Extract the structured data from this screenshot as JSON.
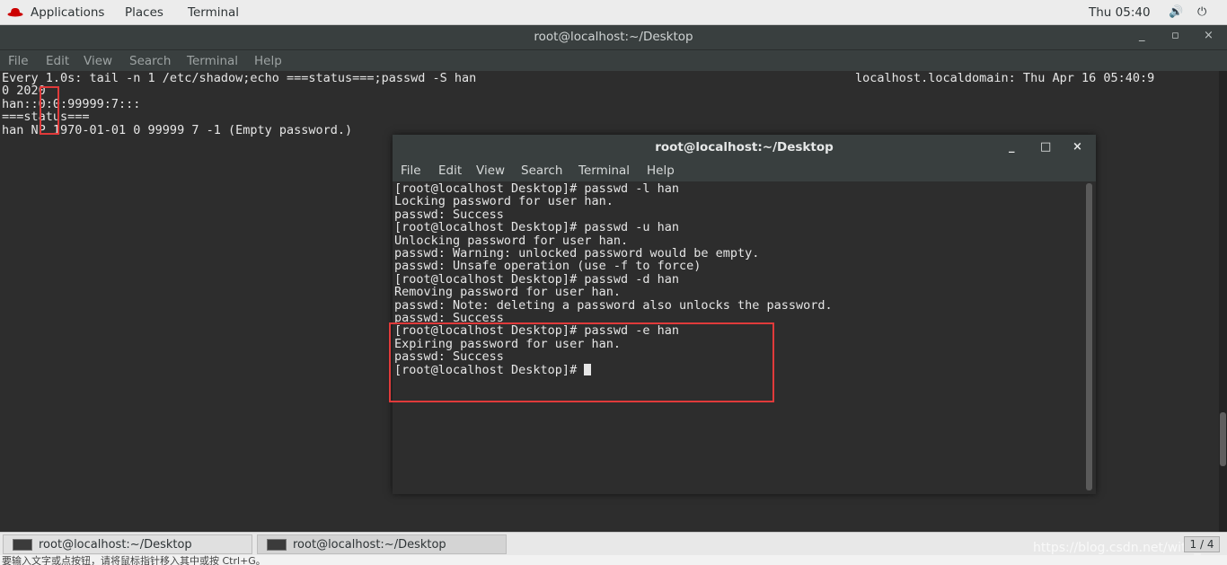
{
  "top_bar": {
    "applications": "Applications",
    "places": "Places",
    "terminal": "Terminal",
    "clock": "Thu 05:40",
    "volume_icon": "volume-icon",
    "power_icon": "power-icon"
  },
  "outer_window": {
    "title": "root@localhost:~/Desktop",
    "minimize": "_",
    "maximize": "▫",
    "close": "×",
    "menu": [
      "File",
      "Edit",
      "View",
      "Search",
      "Terminal",
      "Help"
    ],
    "header_left": "Every 1.0s: tail -n 1 /etc/shadow;echo ===status===;passwd -S han",
    "header_right": "localhost.localdomain: Thu Apr 16 05:40:9",
    "lines": [
      "0 2020",
      "han::0:0:99999:7:::",
      "===status===",
      "han NP 1970-01-01 0 99999 7 -1 (Empty password.)"
    ]
  },
  "inner_window": {
    "title": "root@localhost:~/Desktop",
    "minimize": "_",
    "maximize": "□",
    "close": "×",
    "menu": [
      "File",
      "Edit",
      "View",
      "Search",
      "Terminal",
      "Help"
    ],
    "lines": [
      "[root@localhost Desktop]# passwd -l han",
      "Locking password for user han.",
      "passwd: Success",
      "[root@localhost Desktop]# passwd -u han",
      "Unlocking password for user han.",
      "passwd: Warning: unlocked password would be empty.",
      "passwd: Unsafe operation (use -f to force)",
      "[root@localhost Desktop]# passwd -d han",
      "Removing password for user han.",
      "passwd: Note: deleting a password also unlocks the password.",
      "passwd: Success",
      "[root@localhost Desktop]# passwd -e han",
      "Expiring password for user han.",
      "passwd: Success",
      "[root@localhost Desktop]# "
    ]
  },
  "taskbar": {
    "task1": "root@localhost:~/Desktop",
    "task2": "root@localhost:~/Desktop",
    "pager": "1 / 4",
    "watermark": "https://blog.csdn.net/with_ca"
  },
  "status_strip": "要输入文字或点按钮，请将鼠标指针移入其中或按 Ctrl+G。",
  "annotation_color": "#e03a3a"
}
